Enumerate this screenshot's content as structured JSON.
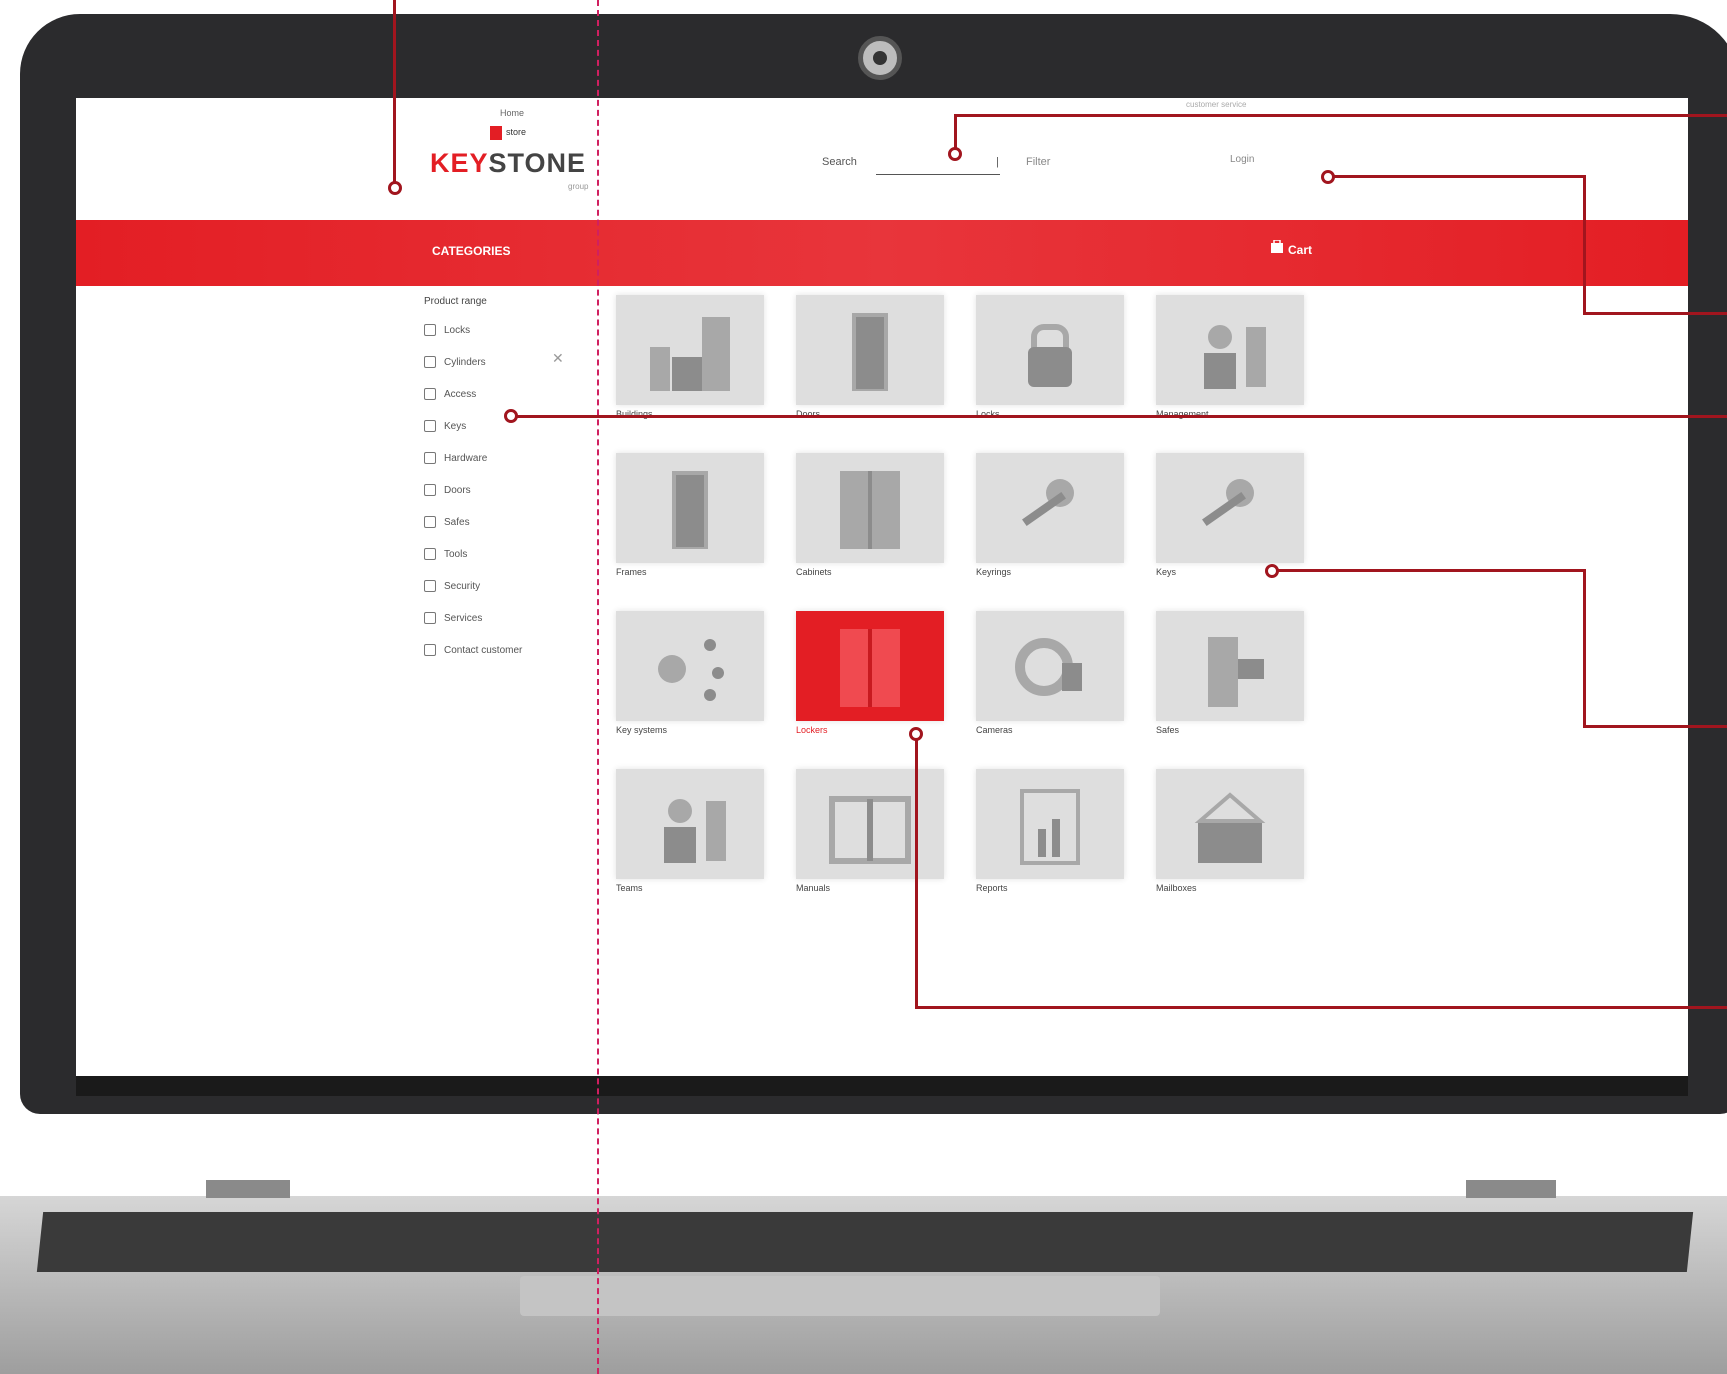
{
  "colors": {
    "accent": "#e31e24",
    "tile": "#dedede",
    "annotation": "#a1151e",
    "bezel": "#2b2b2d"
  },
  "header": {
    "top_link": "Home",
    "small_logo_text": "store",
    "brand_key": "KEY",
    "brand_stone": "STONE",
    "brand_sub": "group",
    "topbar_right": "customer service",
    "search_label": "Search",
    "search_placeholder": "",
    "search_extra": "Filter",
    "account_label": "Login"
  },
  "nav": {
    "title": "CATEGORIES",
    "cart_label": "Cart",
    "cart_icon": "cart-icon"
  },
  "sidebar": {
    "heading": "Product range",
    "close_icon": "close-icon",
    "items": [
      {
        "label": "Locks",
        "icon": "lock-icon"
      },
      {
        "label": "Cylinders",
        "icon": "cylinder-icon"
      },
      {
        "label": "Access",
        "icon": "access-icon"
      },
      {
        "label": "Keys",
        "icon": "key-icon"
      },
      {
        "label": "Hardware",
        "icon": "hardware-icon"
      },
      {
        "label": "Doors",
        "icon": "door-icon"
      },
      {
        "label": "Safes",
        "icon": "safe-icon"
      },
      {
        "label": "Tools",
        "icon": "tool-icon"
      },
      {
        "label": "Security",
        "icon": "shield-icon"
      },
      {
        "label": "Services",
        "icon": "service-icon"
      },
      {
        "label": "Contact customer",
        "icon": "contact-icon"
      }
    ]
  },
  "tiles": [
    {
      "label": "Buildings",
      "icon": "building-icon"
    },
    {
      "label": "Doors",
      "icon": "door-icon"
    },
    {
      "label": "Locks",
      "icon": "padlock-icon"
    },
    {
      "label": "Management",
      "icon": "management-icon"
    },
    {
      "label": "Frames",
      "icon": "frame-icon"
    },
    {
      "label": "Cabinets",
      "icon": "cabinet-icon"
    },
    {
      "label": "Keyrings",
      "icon": "keyring-icon"
    },
    {
      "label": "Keys",
      "icon": "keys-icon"
    },
    {
      "label": "Key systems",
      "icon": "network-icon"
    },
    {
      "label": "Lockers",
      "icon": "locker-icon"
    },
    {
      "label": "Cameras",
      "icon": "camera-icon"
    },
    {
      "label": "Safes",
      "icon": "safe-icon"
    },
    {
      "label": "Teams",
      "icon": "team-icon"
    },
    {
      "label": "Manuals",
      "icon": "book-icon"
    },
    {
      "label": "Reports",
      "icon": "report-icon"
    },
    {
      "label": "Mailboxes",
      "icon": "mailbox-icon"
    }
  ]
}
